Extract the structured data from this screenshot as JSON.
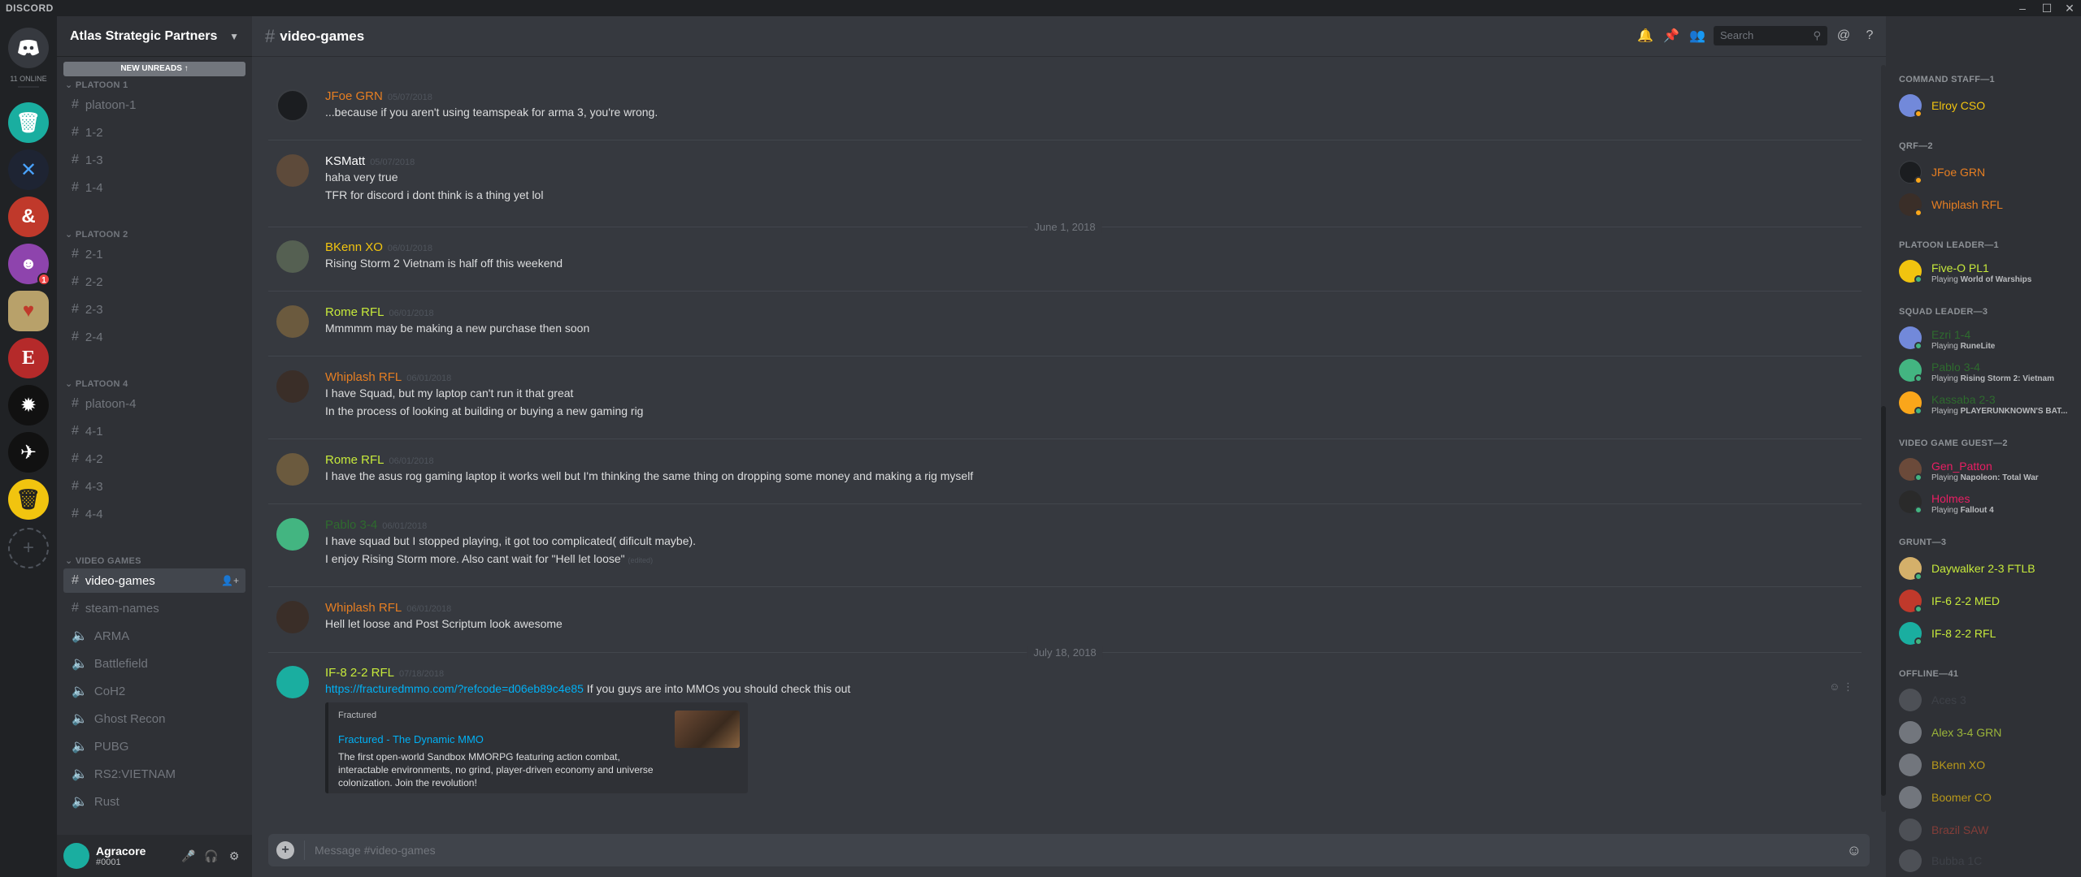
{
  "window": {
    "brand": "DISCORD",
    "min": "–",
    "max": "☐",
    "close": "✕"
  },
  "rail": {
    "online": "11 ONLINE",
    "badge": "1",
    "add": "+"
  },
  "guild": {
    "name": "Atlas Strategic Partners",
    "new_unreads": "NEW UNREADS"
  },
  "categories": {
    "platoon1": "PLATOON 1",
    "platoon2": "PLATOON 2",
    "platoon4": "PLATOON 4",
    "videogames": "VIDEO GAMES"
  },
  "channels": {
    "p1": [
      "platoon-1",
      "1-2",
      "1-3",
      "1-4"
    ],
    "p2": [
      "2-1",
      "2-2",
      "2-3",
      "2-4"
    ],
    "p4": [
      "platoon-4",
      "4-1",
      "4-2",
      "4-3",
      "4-4"
    ],
    "vg": [
      "video-games",
      "steam-names",
      "ARMA",
      "Battlefield",
      "CoH2",
      "Ghost Recon",
      "PUBG",
      "RS2:VIETNAM",
      "Rust"
    ]
  },
  "user": {
    "name": "Agracore",
    "tag": "#0001"
  },
  "chat": {
    "channel": "video-games",
    "search_placeholder": "Search",
    "composer_placeholder": "Message #video-games"
  },
  "messages": [
    {
      "author": "JFoe GRN",
      "ts": "05/07/2018",
      "lines": [
        "...because if you aren't using teamspeak for arma 3, you're wrong."
      ]
    },
    {
      "author": "KSMatt",
      "ts": "05/07/2018",
      "lines": [
        "haha very true",
        "TFR for discord i dont think is a thing yet lol"
      ]
    },
    {
      "author": "BKenn XO",
      "ts": "06/01/2018",
      "lines": [
        "Rising Storm 2 Vietnam is half off this weekend"
      ]
    },
    {
      "author": "Rome RFL",
      "ts": "06/01/2018",
      "lines": [
        "Mmmmm may be making a new purchase then soon"
      ]
    },
    {
      "author": "Whiplash RFL",
      "ts": "06/01/2018",
      "lines": [
        "I have Squad, but my laptop can't run it that great",
        "In the process of looking at building or buying a new gaming rig"
      ]
    },
    {
      "author": "Rome RFL",
      "ts": "06/01/2018",
      "lines": [
        "I have the asus rog gaming laptop it works well but I'm thinking the same thing on dropping some money and making a rig myself"
      ]
    },
    {
      "author": "Pablo 3-4",
      "ts": "06/01/2018",
      "lines": [
        "I have squad but I stopped playing, it got too complicated( dificult maybe).",
        "I enjoy Rising Storm more. Also cant wait for \"Hell let loose\""
      ],
      "edited": "(edited)"
    },
    {
      "author": "Whiplash RFL",
      "ts": "06/01/2018",
      "lines": [
        "Hell let loose and Post Scriptum look awesome"
      ]
    },
    {
      "author": "IF-8 2-2 RFL",
      "ts": "07/18/2018",
      "link": "https://fracturedmmo.com/?refcode=d06eb89c4e85",
      "after_link": " If you guys are into MMOs you should check this out"
    }
  ],
  "dates": {
    "d1": "June 1, 2018",
    "d2": "July 18, 2018"
  },
  "embed": {
    "provider": "Fractured",
    "title": "Fractured - The Dynamic MMO",
    "description": "The first open-world Sandbox MMORPG featuring action combat, interactable environments, no grind, player-driven economy and universe colonization. Join the revolution!"
  },
  "members": {
    "cats": {
      "command": "COMMAND STAFF—1",
      "qrf": "QRF—2",
      "pl": "PLATOON LEADER—1",
      "sl": "SQUAD LEADER—3",
      "vgg": "VIDEO GAME GUEST—2",
      "grunt": "GRUNT—3",
      "offline": "OFFLINE—41"
    },
    "list": [
      {
        "name": "Elroy CSO",
        "activity": ""
      },
      {
        "name": "JFoe GRN",
        "activity": ""
      },
      {
        "name": "Whiplash RFL",
        "activity": ""
      },
      {
        "name": "Five-O PL1",
        "activity_prefix": "Playing ",
        "activity": "World of Warships"
      },
      {
        "name": "Ezri 1-4",
        "activity_prefix": "Playing ",
        "activity": "RuneLite"
      },
      {
        "name": "Pablo 3-4",
        "activity_prefix": "Playing ",
        "activity": "Rising Storm 2: Vietnam"
      },
      {
        "name": "Kassaba 2-3",
        "activity_prefix": "Playing ",
        "activity": "PLAYERUNKNOWN'S BAT..."
      },
      {
        "name": "Gen_Patton",
        "activity_prefix": "Playing ",
        "activity": "Napoleon: Total War"
      },
      {
        "name": "Holmes",
        "activity_prefix": "Playing ",
        "activity": "Fallout 4"
      },
      {
        "name": "Daywalker 2-3 FTLB",
        "activity": ""
      },
      {
        "name": "IF-6 2-2 MED",
        "activity": ""
      },
      {
        "name": "IF-8 2-2 RFL",
        "activity": ""
      },
      {
        "name": "Aces 3",
        "activity": ""
      },
      {
        "name": "Alex 3-4 GRN",
        "activity": ""
      },
      {
        "name": "BKenn XO",
        "activity": ""
      },
      {
        "name": "Boomer CO",
        "activity": ""
      },
      {
        "name": "Brazil SAW",
        "activity": ""
      },
      {
        "name": "Bubba 1C",
        "activity": ""
      }
    ]
  },
  "colors": {
    "orange": "#e67e22",
    "lime": "#c6e93b",
    "gold": "#f1c40f",
    "green": "#2ecc71",
    "pink": "#e91e63",
    "red": "#e74c3c",
    "teal": "#1abc9c"
  }
}
